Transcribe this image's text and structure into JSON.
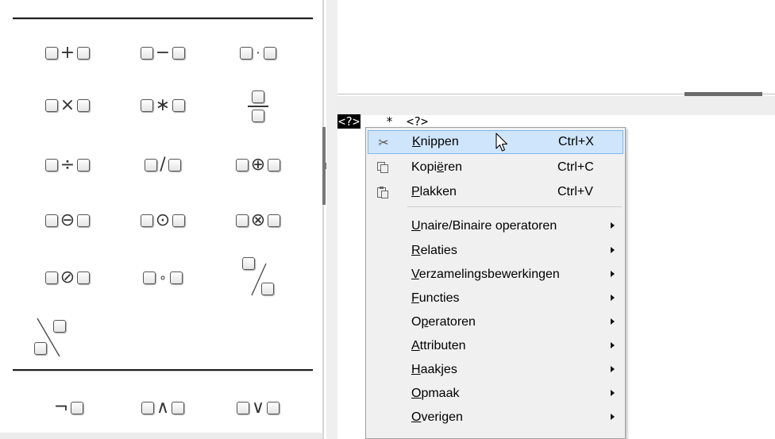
{
  "left_panel": {
    "row1": [
      "+",
      "−",
      "·"
    ],
    "row2": [
      "×",
      "∗"
    ],
    "row3": [
      "÷",
      "/",
      "⊕"
    ],
    "row4": [
      "⊖",
      "⊙",
      "⊗"
    ],
    "row5": [
      "⊘",
      "∘"
    ],
    "row6": [
      "¬",
      "∧",
      "∨"
    ]
  },
  "editor": {
    "token_selected": "<?>",
    "token_op": "*",
    "token_next": "<?>"
  },
  "context_menu": {
    "items": [
      {
        "label": "Knippen",
        "mnemonic": "K",
        "shortcut": "Ctrl+X",
        "icon": "scissors-icon",
        "highlighted": true
      },
      {
        "label": "Kopiëren",
        "mnemonic": "ë",
        "shortcut": "Ctrl+C",
        "icon": "copy-icon"
      },
      {
        "label": "Plakken",
        "mnemonic": "P",
        "shortcut": "Ctrl+V",
        "icon": "paste-icon"
      }
    ],
    "submenus": [
      "Unaire/Binaire operatoren",
      "Relaties",
      "Verzamelingsbewerkingen",
      "Functies",
      "Operatoren",
      "Attributen",
      "Haakjes",
      "Opmaak",
      "Overigen"
    ]
  },
  "colors": {
    "highlight_bg": "#cfe5fb",
    "highlight_border": "#7db7ee",
    "menu_bg": "#f0f0f0"
  }
}
